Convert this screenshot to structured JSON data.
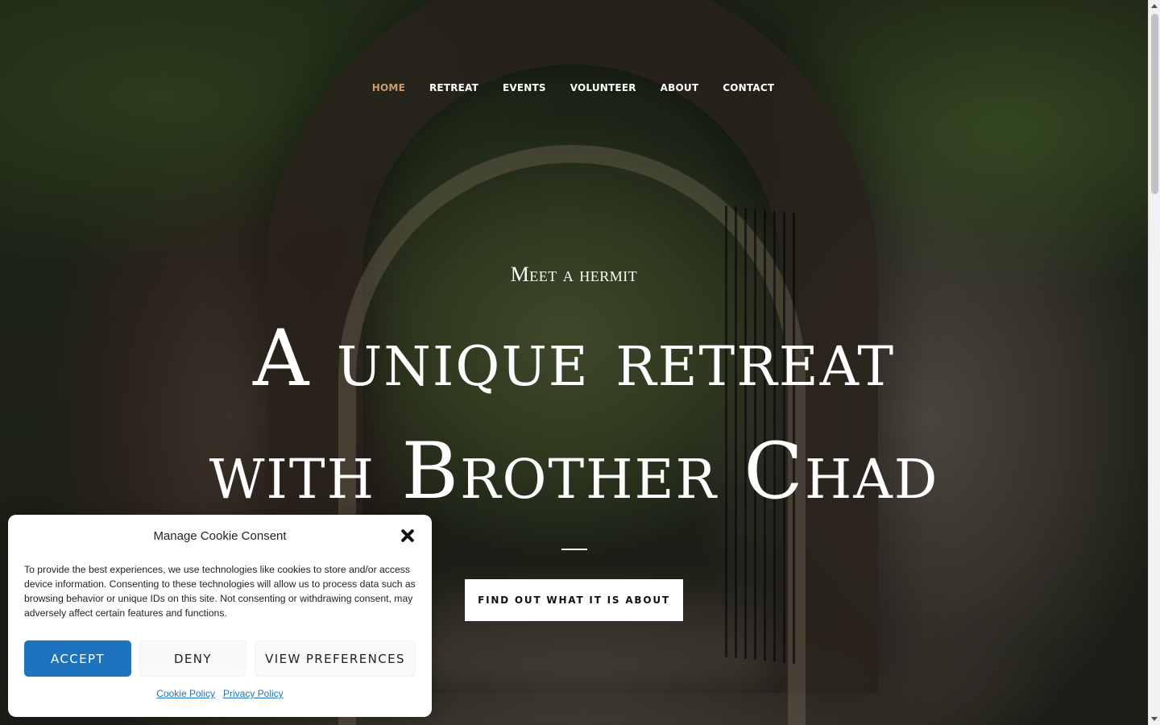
{
  "nav": {
    "items": [
      {
        "label": "HOME",
        "active": true
      },
      {
        "label": "RETREAT",
        "active": false
      },
      {
        "label": "EVENTS",
        "active": false
      },
      {
        "label": "VOLUNTEER",
        "active": false
      },
      {
        "label": "ABOUT",
        "active": false
      },
      {
        "label": "CONTACT",
        "active": false
      }
    ],
    "active_color": "#c89a6e"
  },
  "hero": {
    "kicker": "Meet a hermit",
    "headline_line1": "A unique retreat",
    "headline_line2": "with Brother Chad",
    "cta_label": "FIND OUT WHAT IT IS ABOUT"
  },
  "cookie_dialog": {
    "title": "Manage Cookie Consent",
    "close_icon": "close-icon",
    "body": "To provide the best experiences, we use technologies like cookies to store and/or access device information. Consenting to these technologies will allow us to process data such as browsing behavior or unique IDs on this site. Not consenting or withdrawing consent, may adversely affect certain features and functions.",
    "accept_label": "ACCEPT",
    "deny_label": "DENY",
    "preferences_label": "VIEW PREFERENCES",
    "cookie_policy_label": "Cookie Policy",
    "privacy_policy_label": "Privacy Policy",
    "accent_color": "#1e73be"
  }
}
